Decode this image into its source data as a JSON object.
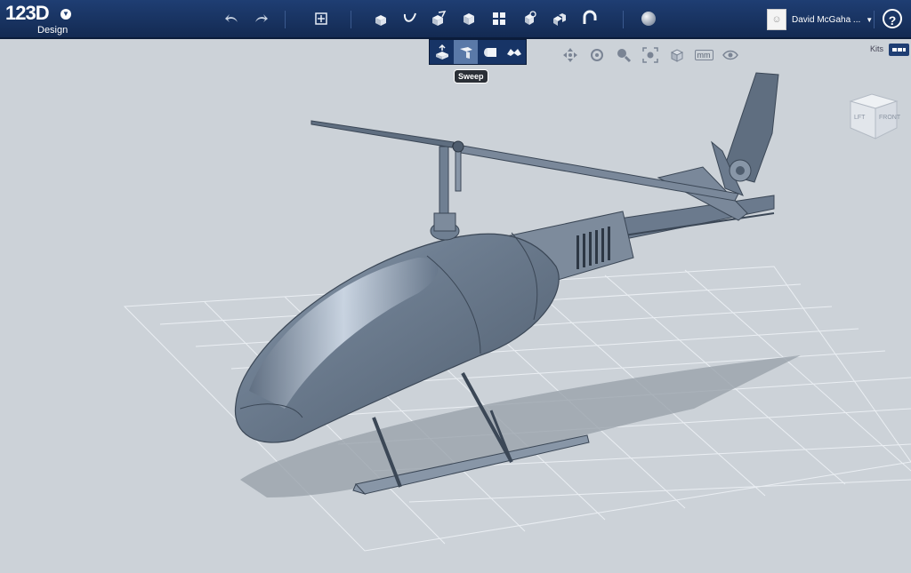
{
  "app": {
    "name": "123D",
    "subtitle": "Design"
  },
  "toolbar": {
    "undo": "undo-icon",
    "redo": "redo-icon",
    "transform": "transform-icon",
    "primitives": "primitives-icon",
    "sketch": "sketch-icon",
    "construct": "construct-icon",
    "modify": "modify-icon",
    "pattern": "pattern-icon",
    "grouping": "grouping-icon",
    "combine": "combine-icon",
    "snap": "snap-icon",
    "material": "material-icon"
  },
  "construct_submenu": {
    "items": [
      "extrude",
      "sweep",
      "revolve",
      "loft"
    ],
    "active": "sweep",
    "tooltip": "Sweep"
  },
  "user": {
    "name": "David McGaha ..."
  },
  "help_label": "?",
  "nav": [
    "pan",
    "orbit",
    "zoom",
    "fit",
    "view-options",
    "units",
    "visibility"
  ],
  "units_label": "mm",
  "kits_label": "Kits",
  "viewcube": {
    "left": "LFT",
    "front": "FRONT"
  },
  "colors": {
    "topbar": "#1a3666",
    "viewport": "#ccd2d8",
    "model": "#6d7c8e",
    "grid": "#ffffff"
  }
}
